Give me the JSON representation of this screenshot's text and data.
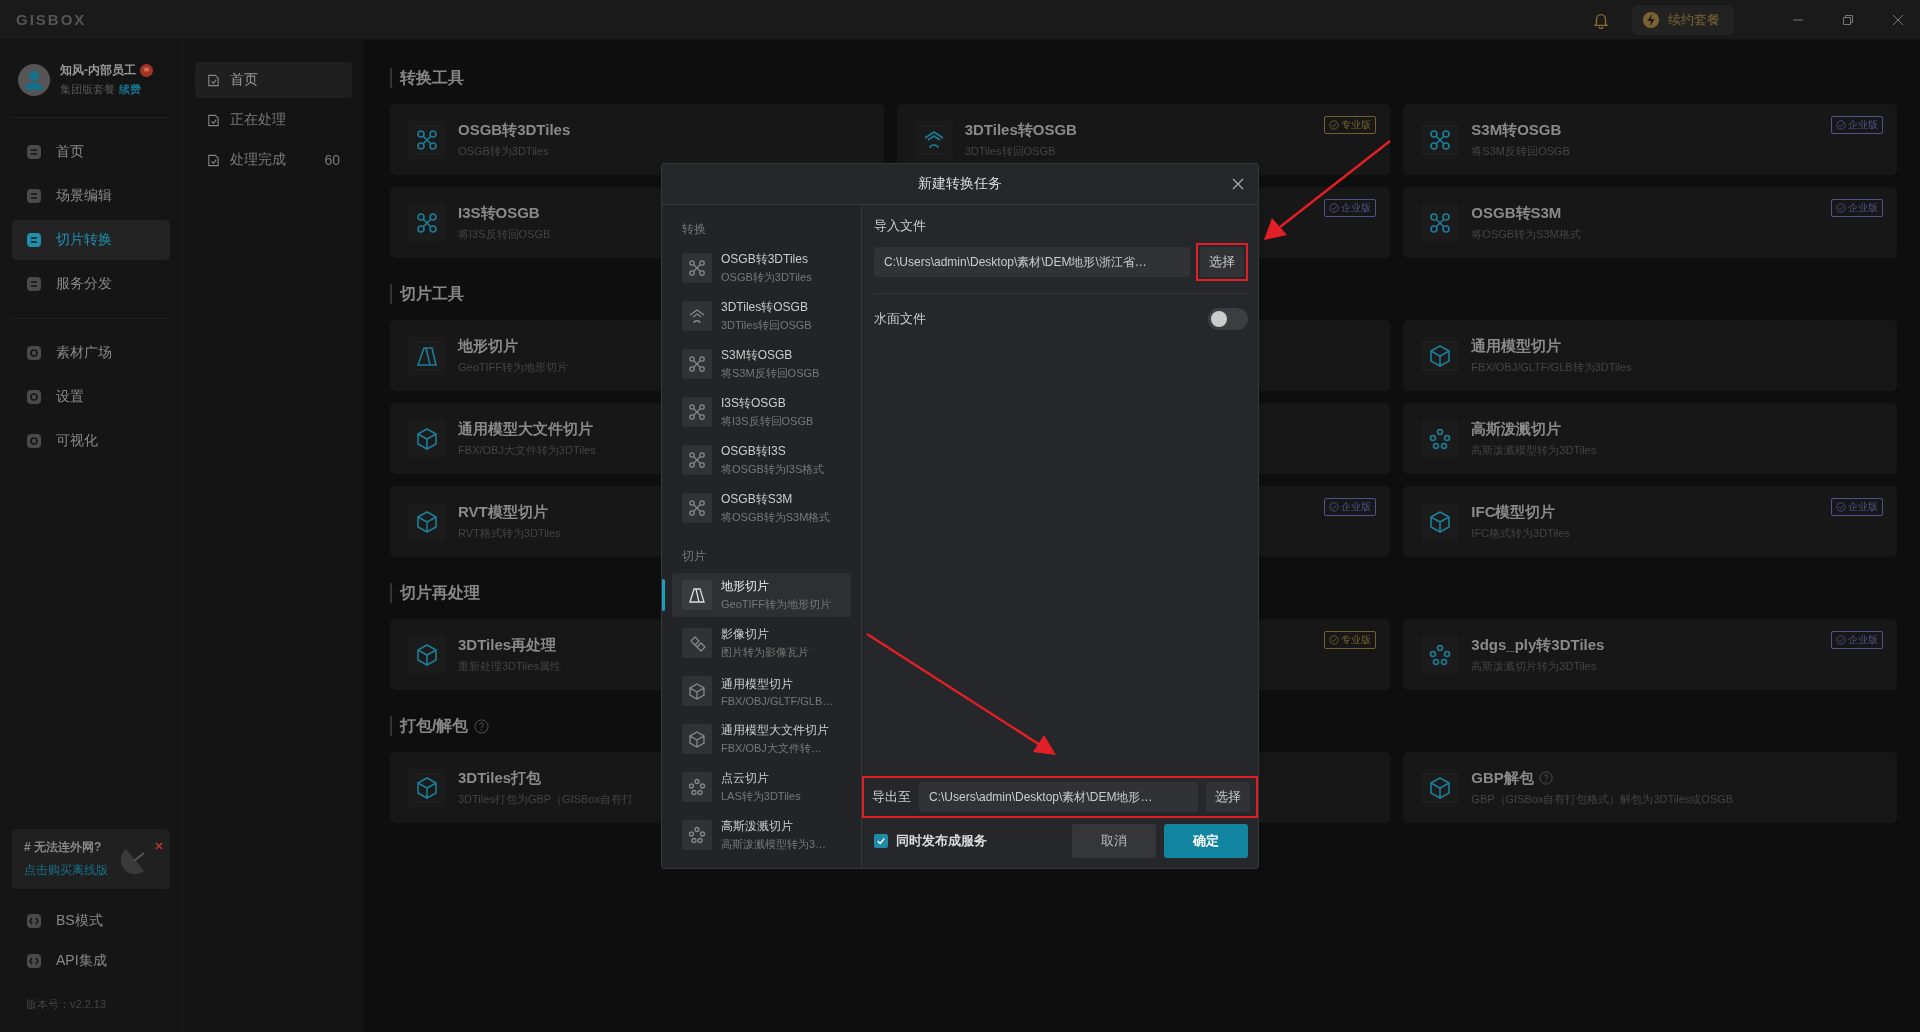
{
  "app": {
    "logo": "GISBOX",
    "renew_button": "续约套餐"
  },
  "user": {
    "name": "知风-内部员工",
    "plan": "集团版套餐",
    "renew_link": "续费"
  },
  "nav": {
    "main": [
      {
        "label": "首页",
        "selected": false
      },
      {
        "label": "场景编辑",
        "selected": false
      },
      {
        "label": "切片转换",
        "selected": true
      },
      {
        "label": "服务分发",
        "selected": false
      }
    ],
    "more": [
      {
        "label": "素材广场",
        "selected": false
      },
      {
        "label": "设置",
        "selected": false
      },
      {
        "label": "可视化",
        "selected": false
      }
    ],
    "promo": {
      "title": "# 无法连外网?",
      "link": "点击购买离线版"
    },
    "bottom": [
      {
        "label": "BS模式"
      },
      {
        "label": "API集成"
      }
    ],
    "version": "版本号：v2.2.13"
  },
  "subnav": [
    {
      "label": "首页",
      "selected": true
    },
    {
      "label": "正在处理",
      "selected": false
    },
    {
      "label": "处理完成",
      "count": "60",
      "selected": false
    }
  ],
  "sections": [
    {
      "title": "转换工具",
      "cards": [
        {
          "kind": "tool",
          "title": "OSGB转3DTiles",
          "subtitle": "OSGB转为3DTiles"
        },
        {
          "kind": "tool",
          "title": "3DTiles转OSGB",
          "subtitle": "3DTiles转回OSGB",
          "badge": {
            "label": "专业版",
            "kind": "pro"
          }
        },
        {
          "kind": "tool",
          "title": "S3M转OSGB",
          "subtitle": "将S3M反转回OSGB",
          "badge": {
            "label": "企业版",
            "kind": "enterprise"
          }
        },
        {
          "kind": "tool",
          "title": "I3S转OSGB",
          "subtitle": "将I3S反转回OSGB"
        },
        {
          "kind": "covered",
          "badge": {
            "label": "企业版",
            "kind": "enterprise"
          }
        },
        {
          "kind": "tool",
          "title": "OSGB转S3M",
          "subtitle": "将OSGB转为S3M格式",
          "badge": {
            "label": "企业版",
            "kind": "enterprise"
          }
        }
      ]
    },
    {
      "title": "切片工具",
      "cards": [
        {
          "kind": "tool",
          "title": "地形切片",
          "subtitle": "GeoTIFF转为地形切片"
        },
        {
          "kind": "covered"
        },
        {
          "kind": "tool",
          "title": "通用模型切片",
          "subtitle": "FBX/OBJ/GLTF/GLB转为3DTiles"
        },
        {
          "kind": "tool",
          "title": "通用模型大文件切片",
          "subtitle": "FBX/OBJ大文件转为3DTiles"
        },
        {
          "kind": "covered"
        },
        {
          "kind": "tool",
          "title": "高斯泼溅切片",
          "subtitle": "高斯泼溅模型转为3DTiles"
        },
        {
          "kind": "tool",
          "title": "RVT模型切片",
          "subtitle": "RVT格式转为3DTiles"
        },
        {
          "kind": "covered",
          "badge": {
            "label": "企业版",
            "kind": "enterprise"
          }
        },
        {
          "kind": "tool",
          "title": "IFC模型切片",
          "subtitle": "IFC格式转为3DTiles",
          "badge": {
            "label": "企业版",
            "kind": "enterprise"
          }
        }
      ]
    },
    {
      "title": "切片再处理",
      "cards": [
        {
          "kind": "tool",
          "title": "3DTiles再处理",
          "subtitle": "重新处理3DTiles属性"
        },
        {
          "kind": "covered",
          "badge": {
            "label": "专业版",
            "kind": "pro"
          }
        },
        {
          "kind": "tool",
          "title": "3dgs_ply转3DTiles",
          "subtitle": "高斯泼溅切片转为3DTiles",
          "badge": {
            "label": "企业版",
            "kind": "enterprise"
          }
        }
      ]
    },
    {
      "title": "打包/解包",
      "help": true,
      "cards": [
        {
          "kind": "tool",
          "title": "3DTiles打包",
          "subtitle": "3DTiles打包为GBP（GISBox自有打"
        },
        {
          "kind": "covered"
        },
        {
          "kind": "tool",
          "title": "GBP解包",
          "help": true,
          "subtitle": "GBP（GISBox自有打包格式）解包为3DTiles或OSGB"
        }
      ]
    }
  ],
  "dialog": {
    "title": "新建转换任务",
    "groups": [
      {
        "label": "转换",
        "items": [
          {
            "title": "OSGB转3DTiles",
            "subtitle": "OSGB转为3DTiles",
            "selected": false
          },
          {
            "title": "3DTiles转OSGB",
            "subtitle": "3DTiles转回OSGB",
            "selected": false
          },
          {
            "title": "S3M转OSGB",
            "subtitle": "将S3M反转回OSGB",
            "selected": false
          },
          {
            "title": "I3S转OSGB",
            "subtitle": "将I3S反转回OSGB",
            "selected": false
          },
          {
            "title": "OSGB转I3S",
            "subtitle": "将OSGB转为I3S格式",
            "selected": false
          },
          {
            "title": "OSGB转S3M",
            "subtitle": "将OSGB转为S3M格式",
            "selected": false
          }
        ]
      },
      {
        "label": "切片",
        "items": [
          {
            "title": "地形切片",
            "subtitle": "GeoTIFF转为地形切片",
            "selected": true
          },
          {
            "title": "影像切片",
            "subtitle": "图片转为影像瓦片",
            "selected": false
          },
          {
            "title": "通用模型切片",
            "subtitle": "FBX/OBJ/GLTF/GLB…",
            "selected": false
          },
          {
            "title": "通用模型大文件切片",
            "subtitle": "FBX/OBJ大文件转…",
            "selected": false
          },
          {
            "title": "点云切片",
            "subtitle": "LAS转为3DTiles",
            "selected": false
          },
          {
            "title": "高斯泼溅切片",
            "subtitle": "高斯泼溅模型转为3…",
            "selected": false
          }
        ]
      }
    ],
    "import": {
      "label": "导入文件",
      "value": "C:\\Users\\admin\\Desktop\\素材\\DEM地形\\浙江省…",
      "button": "选择"
    },
    "water": {
      "label": "水面文件",
      "on": false
    },
    "export": {
      "label": "导出至",
      "value": "C:\\Users\\admin\\Desktop\\素材\\DEM地形…",
      "button": "选择"
    },
    "publish": {
      "label": "同时发布成服务",
      "checked": true
    },
    "cancel": "取消",
    "confirm": "确定"
  }
}
